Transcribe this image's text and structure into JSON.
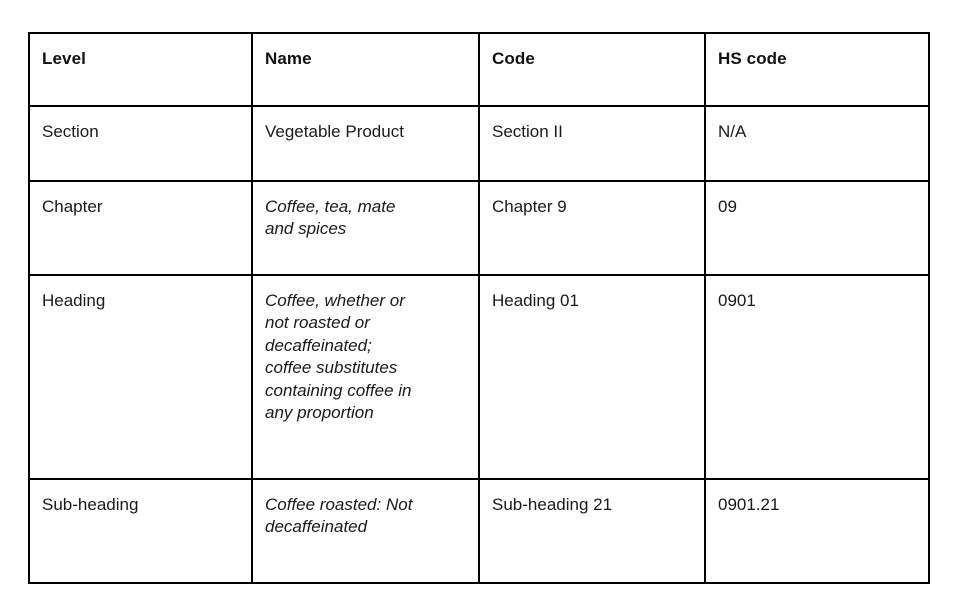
{
  "table": {
    "name": "hs-classification-table",
    "columns": [
      "Level",
      "Name",
      "Code",
      "HS code"
    ],
    "rows": [
      {
        "level": "Section",
        "name": "Vegetable Product",
        "name_italic": false,
        "code": "Section II",
        "hs_code": "N/A"
      },
      {
        "level": "Chapter",
        "name": "Coffee, tea, mate\nand spices",
        "name_italic": true,
        "code": "Chapter 9",
        "hs_code": "09"
      },
      {
        "level": "Heading",
        "name": "Coffee, whether or\nnot roasted or\ndecaffeinated;\ncoffee substitutes\ncontaining coffee in\nany proportion",
        "name_italic": true,
        "code": "Heading 01",
        "hs_code": "0901"
      },
      {
        "level": "Sub-heading",
        "name": "Coffee roasted: Not\ndecaffeinated",
        "name_italic": true,
        "code": "Sub-heading 21",
        "hs_code": "0901.21"
      }
    ]
  },
  "colors": {
    "background": "#ffffff",
    "border": "#000000",
    "text": "#1a1a1a",
    "header_text": "#111111"
  }
}
